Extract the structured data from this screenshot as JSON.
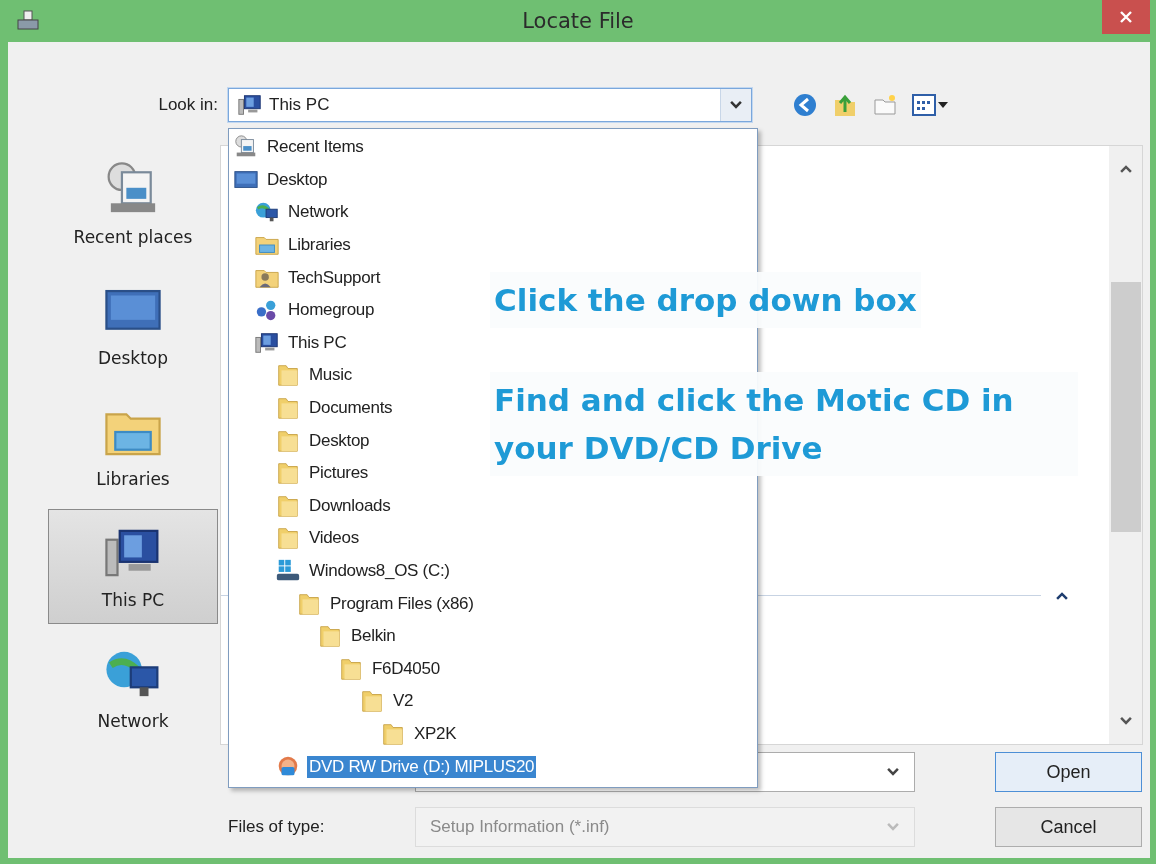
{
  "window": {
    "title": "Locate File"
  },
  "look_in": {
    "label": "Look in:",
    "value": "This PC",
    "kind": "computer",
    "expanded": true
  },
  "places": [
    {
      "label": "Recent places",
      "kind": "recent",
      "selected": false
    },
    {
      "label": "Desktop",
      "kind": "desktop",
      "selected": false
    },
    {
      "label": "Libraries",
      "kind": "library",
      "selected": false
    },
    {
      "label": "This PC",
      "kind": "computer",
      "selected": true
    },
    {
      "label": "Network",
      "kind": "network",
      "selected": false
    }
  ],
  "location_list": [
    {
      "label": "Recent Items",
      "kind": "recent",
      "selected": false
    },
    {
      "label": "Desktop",
      "kind": "desktop",
      "selected": false,
      "children": [
        {
          "label": "Network",
          "kind": "network",
          "selected": false
        },
        {
          "label": "Libraries",
          "kind": "library",
          "selected": false
        },
        {
          "label": "TechSupport",
          "kind": "user",
          "selected": false
        },
        {
          "label": "Homegroup",
          "kind": "homegroup",
          "selected": false
        },
        {
          "label": "This PC",
          "kind": "computer",
          "selected": false,
          "children": [
            {
              "label": "Music",
              "kind": "folder",
              "selected": false
            },
            {
              "label": "Documents",
              "kind": "folder",
              "selected": false
            },
            {
              "label": "Desktop",
              "kind": "folder",
              "selected": false
            },
            {
              "label": "Pictures",
              "kind": "folder",
              "selected": false
            },
            {
              "label": "Downloads",
              "kind": "folder",
              "selected": false
            },
            {
              "label": "Videos",
              "kind": "folder",
              "selected": false
            },
            {
              "label": "Windows8_OS (C:)",
              "kind": "drive",
              "selected": false,
              "children": [
                {
                  "label": "Program Files (x86)",
                  "kind": "folder",
                  "selected": false,
                  "children": [
                    {
                      "label": "Belkin",
                      "kind": "folder",
                      "selected": false,
                      "children": [
                        {
                          "label": "F6D4050",
                          "kind": "folder",
                          "selected": false,
                          "children": [
                            {
                              "label": "V2",
                              "kind": "folder",
                              "selected": false,
                              "children": [
                                {
                                  "label": "XP2K",
                                  "kind": "folder",
                                  "selected": false
                                }
                              ]
                            }
                          ]
                        }
                      ]
                    }
                  ]
                }
              ]
            },
            {
              "label": "DVD RW Drive (D:) MIPLUS20",
              "kind": "dvd",
              "selected": true
            }
          ]
        }
      ]
    }
  ],
  "overlay_notes": [
    "Click the drop down box",
    "Find and click the Motic CD in your DVD/CD Drive"
  ],
  "file_type": {
    "label": "Files of type:",
    "value": "Setup Information (*.inf)",
    "disabled": true
  },
  "buttons": [
    {
      "label": "Open",
      "kind": "default"
    },
    {
      "label": "Cancel",
      "kind": "normal"
    }
  ]
}
